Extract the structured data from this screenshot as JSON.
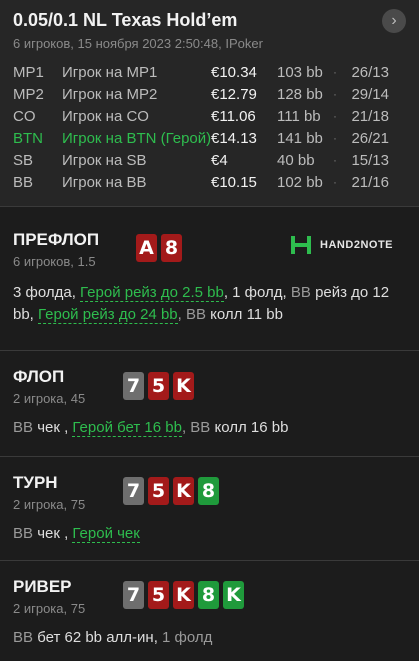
{
  "header": {
    "title": "0.05/0.1 NL Texas Hold’em",
    "subtitle": "6 игроков, 15 ноября 2023 2:50:48, IPoker",
    "nav_glyph": "›"
  },
  "players": [
    {
      "pos": "MP1",
      "name": "Игрок на MP1",
      "stack": "€10.34",
      "bb": "103 bb",
      "sep": "·",
      "cards": "26/13"
    },
    {
      "pos": "MP2",
      "name": "Игрок на MP2",
      "stack": "€12.79",
      "bb": "128 bb",
      "sep": "·",
      "cards": "29/14"
    },
    {
      "pos": "CO",
      "name": "Игрок на CO",
      "stack": "€11.06",
      "bb": "111 bb",
      "sep": "·",
      "cards": "21/18"
    },
    {
      "pos": "BTN",
      "name": "Игрок на BTN (Герой)",
      "stack": "€14.13",
      "bb": "141 bb",
      "sep": "·",
      "cards": "26/21"
    },
    {
      "pos": "SB",
      "name": "Игрок на SB",
      "stack": "€4",
      "bb": "40 bb",
      "sep": "·",
      "cards": "15/13"
    },
    {
      "pos": "BB",
      "name": "Игрок на BB",
      "stack": "€10.15",
      "bb": "102 bb",
      "sep": "·",
      "cards": "21/16"
    }
  ],
  "streets": {
    "preflop": {
      "title": "ПРЕФЛОП",
      "sub": "6 игроков, 1.5",
      "cards": [
        "A",
        "8"
      ],
      "logo": "HAND2NOTE",
      "a1": "3 фолда, ",
      "a2": "Герой рейз до 2.5 bb",
      "a3": ", 1 фолд, ",
      "a4": "BB ",
      "a5": "рейз до 12 bb, ",
      "a6": "Герой рейз до 24 bb",
      "a7": ", BB ",
      "a8": "колл 11 bb"
    },
    "flop": {
      "title": "ФЛОП",
      "sub": "2 игрока, 45",
      "cards": [
        "7",
        "5",
        "K"
      ],
      "a1": "BB ",
      "a2": "чек , ",
      "a3": "Герой бет 16 bb",
      "a4": ", BB ",
      "a5": "колл 16 bb"
    },
    "turn": {
      "title": "ТУРН",
      "sub": "2 игрока, 75",
      "cards": [
        "7",
        "5",
        "K",
        "8"
      ],
      "a1": "BB ",
      "a2": "чек , ",
      "a3": "Герой чек"
    },
    "river": {
      "title": "РИВЕР",
      "sub": "2 игрока, 75",
      "cards": [
        "7",
        "5",
        "K",
        "8",
        "K"
      ],
      "a1": "BB ",
      "a2": "бет 62 bb алл-ин, ",
      "a3": "1 фолд"
    }
  },
  "colors": {
    "background": "#1c1c1c",
    "header": "#262626",
    "hero": "#2ebd4e",
    "red_card": "#a31a1a",
    "gray_card": "#6e6e6e",
    "green_card": "#1f9a3b"
  }
}
